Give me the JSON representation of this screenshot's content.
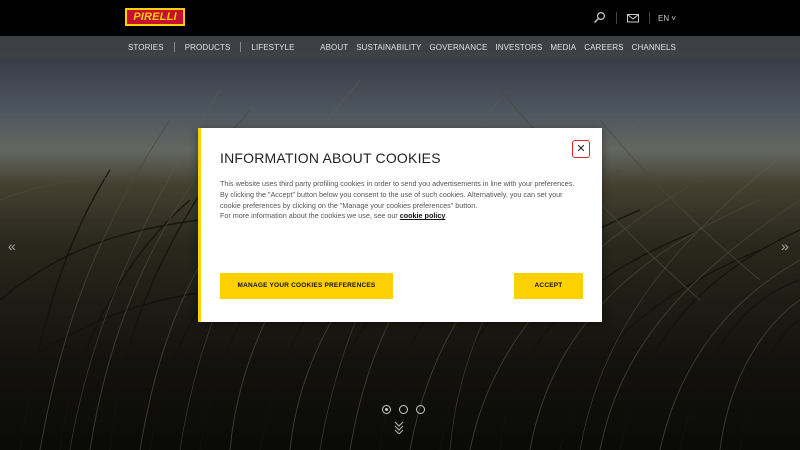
{
  "brand": {
    "logo_text": "PIRELLI",
    "accent_color": "#fdd000",
    "logo_red": "#c8102e"
  },
  "header": {
    "icons": [
      "search-icon",
      "mail-icon"
    ],
    "language": "EN ˅"
  },
  "nav": {
    "left": [
      "STORIES",
      "PRODUCTS",
      "LIFESTYLE"
    ],
    "right": [
      "ABOUT",
      "SUSTAINABILITY",
      "GOVERNANCE",
      "INVESTORS",
      "MEDIA",
      "CAREERS",
      "CHANNELS"
    ]
  },
  "modal": {
    "title": "INFORMATION ABOUT COOKIES",
    "para1": "This website uses third party profiling cookies in order to send you advertisements in line with your preferences.",
    "para2": "By clicking the \"Accept\" button below you consent to the use of such cookies. Alternatively, you can set your cookie preferences by clicking on the \"Manage your cookies preferences\" button.",
    "para3": "For more information about the cookies we use, see our ",
    "policy_link": "cookie policy",
    "period": ".",
    "manage_label": "MANAGE YOUR COOKIES PREFERENCES",
    "accept_label": "ACCEPT",
    "close_symbol": "✕"
  },
  "carousel": {
    "prev_symbol": "«",
    "next_symbol": "»",
    "slide_count": 3,
    "active_index": 0,
    "scroll_symbol": "⌄"
  }
}
